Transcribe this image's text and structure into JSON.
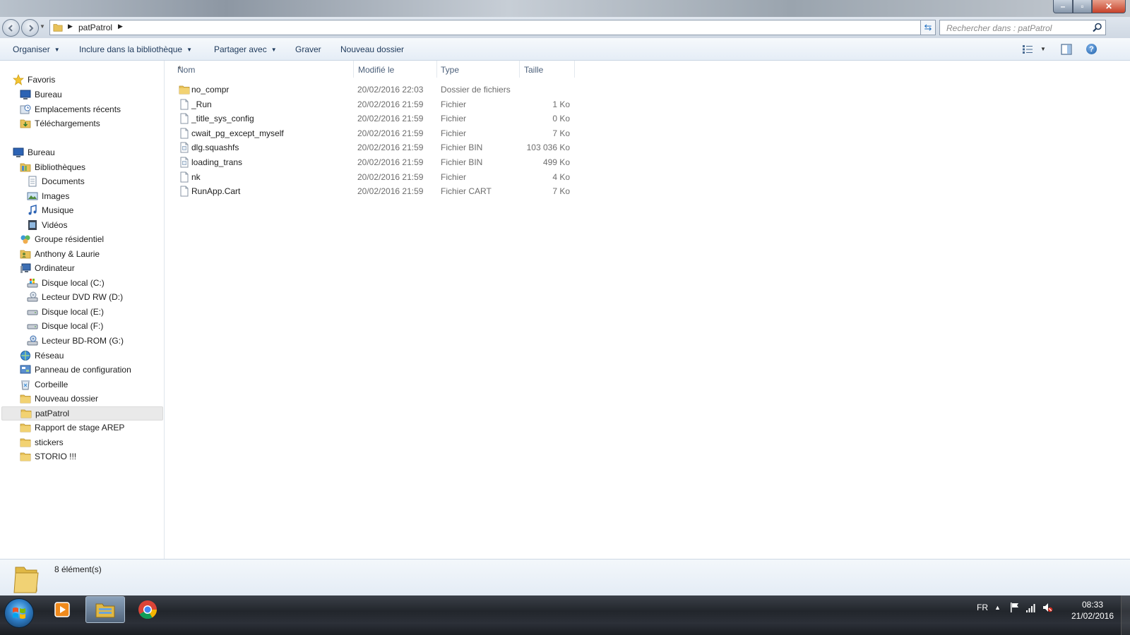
{
  "window": {
    "buttons": {
      "minimize": "–",
      "maximize": "▫",
      "close": "✕"
    }
  },
  "address": {
    "crumb": "patPatrol",
    "search_placeholder": "Rechercher dans : patPatrol"
  },
  "commands": {
    "organize": "Organiser",
    "include": "Inclure dans la bibliothèque",
    "share": "Partager avec",
    "burn": "Graver",
    "new_folder": "Nouveau dossier"
  },
  "nav": {
    "items": [
      {
        "label": "Favoris",
        "icon": "star-icon"
      },
      {
        "label": "Bureau",
        "icon": "desktop-icon"
      },
      {
        "label": "Emplacements récents",
        "icon": "recent-places-icon"
      },
      {
        "label": "Téléchargements",
        "icon": "downloads-folder-icon"
      },
      {
        "label": "Bureau",
        "icon": "desktop-icon"
      },
      {
        "label": "Bibliothèques",
        "icon": "libraries-icon"
      },
      {
        "label": "Documents",
        "icon": "documents-icon"
      },
      {
        "label": "Images",
        "icon": "pictures-icon"
      },
      {
        "label": "Musique",
        "icon": "music-icon"
      },
      {
        "label": "Vidéos",
        "icon": "videos-icon"
      },
      {
        "label": "Groupe résidentiel",
        "icon": "homegroup-icon"
      },
      {
        "label": "Anthony & Laurie",
        "icon": "user-folder-icon"
      },
      {
        "label": "Ordinateur",
        "icon": "computer-icon"
      },
      {
        "label": "Disque local (C:)",
        "icon": "system-drive-icon"
      },
      {
        "label": "Lecteur DVD RW (D:)",
        "icon": "dvd-drive-icon"
      },
      {
        "label": "Disque local (E:)",
        "icon": "hard-drive-icon"
      },
      {
        "label": "Disque local (F:)",
        "icon": "hard-drive-icon"
      },
      {
        "label": "Lecteur BD-ROM (G:)",
        "icon": "bd-drive-icon"
      },
      {
        "label": "Réseau",
        "icon": "network-icon"
      },
      {
        "label": "Panneau de configuration",
        "icon": "control-panel-icon"
      },
      {
        "label": "Corbeille",
        "icon": "recycle-bin-icon"
      },
      {
        "label": "Nouveau dossier",
        "icon": "folder-icon"
      },
      {
        "label": "patPatrol",
        "icon": "folder-icon"
      },
      {
        "label": "Rapport de stage AREP",
        "icon": "folder-icon"
      },
      {
        "label": "stickers",
        "icon": "folder-icon"
      },
      {
        "label": "STORIO !!!",
        "icon": "folder-icon"
      }
    ]
  },
  "columns": {
    "name": "Nom",
    "modified": "Modifié le",
    "type": "Type",
    "size": "Taille"
  },
  "files": [
    {
      "name": "no_compr",
      "modified": "20/02/2016 22:03",
      "type": "Dossier de fichiers",
      "size": "",
      "icon": "folder-icon"
    },
    {
      "name": "_Run",
      "modified": "20/02/2016 21:59",
      "type": "Fichier",
      "size": "1 Ko",
      "icon": "file-icon"
    },
    {
      "name": "_title_sys_config",
      "modified": "20/02/2016 21:59",
      "type": "Fichier",
      "size": "0 Ko",
      "icon": "file-icon"
    },
    {
      "name": "cwait_pg_except_myself",
      "modified": "20/02/2016 21:59",
      "type": "Fichier",
      "size": "7 Ko",
      "icon": "file-icon"
    },
    {
      "name": "dlg.squashfs",
      "modified": "20/02/2016 21:59",
      "type": "Fichier BIN",
      "size": "103 036 Ko",
      "icon": "bin-file-icon"
    },
    {
      "name": "loading_trans",
      "modified": "20/02/2016 21:59",
      "type": "Fichier BIN",
      "size": "499 Ko",
      "icon": "bin-file-icon"
    },
    {
      "name": "nk",
      "modified": "20/02/2016 21:59",
      "type": "Fichier",
      "size": "4 Ko",
      "icon": "file-icon"
    },
    {
      "name": "RunApp.Cart",
      "modified": "20/02/2016 21:59",
      "type": "Fichier CART",
      "size": "7 Ko",
      "icon": "file-icon"
    }
  ],
  "status": {
    "count": "8 élément(s)"
  },
  "taskbar": {
    "apps": [
      "media-player-icon",
      "explorer-icon",
      "chrome-icon"
    ],
    "lang": "FR",
    "tray_arrow": "▲",
    "time": "08:33",
    "date": "21/02/2016"
  },
  "colors": {
    "accent": "#1e395b",
    "selection": "#e9e9e9",
    "header_text": "#4c607a"
  }
}
